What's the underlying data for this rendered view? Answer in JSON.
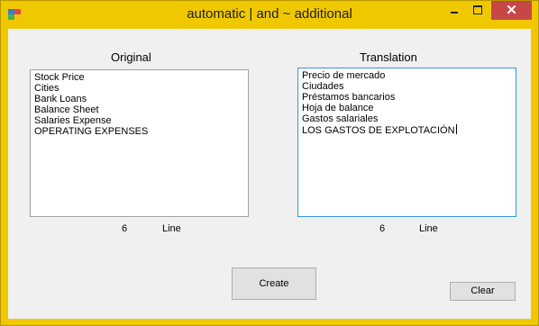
{
  "window": {
    "title": "automatic | and ~ additional",
    "controls": {
      "minimize_icon": "minimize-icon",
      "maximize_icon": "maximize-icon",
      "close_icon": "close-icon",
      "close_glyph": "✕"
    },
    "colors": {
      "frame": "#f0c800",
      "close": "#c74747"
    }
  },
  "original": {
    "label": "Original",
    "lines": [
      "Stock Price",
      "Cities",
      "Bank Loans",
      "Balance Sheet",
      "Salaries Expense",
      "OPERATING EXPENSES"
    ],
    "count": "6",
    "count_label": "Line"
  },
  "translation": {
    "label": "Translation",
    "lines": [
      "Precio de mercado",
      "Ciudades",
      "Préstamos bancarios",
      "Hoja de balance",
      "Gastos salariales",
      "LOS GASTOS DE EXPLOTACIÓN"
    ],
    "count": "6",
    "count_label": "Line"
  },
  "buttons": {
    "create": "Create",
    "clear": "Clear"
  }
}
